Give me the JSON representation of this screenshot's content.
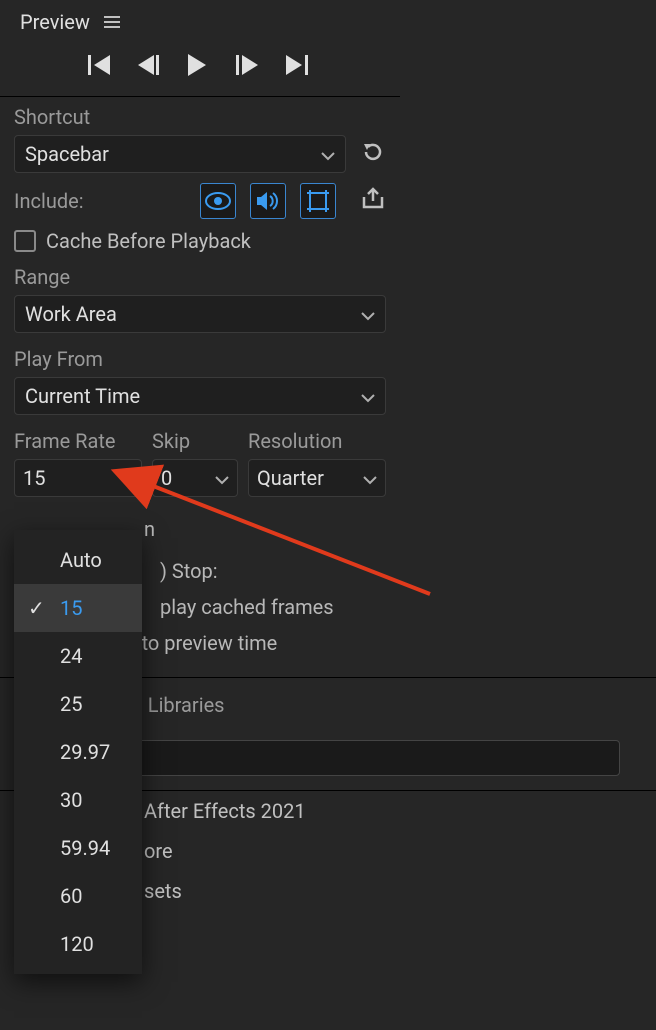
{
  "panel": {
    "title": "Preview"
  },
  "shortcut": {
    "label": "Shortcut",
    "value": "Spacebar"
  },
  "include": {
    "label": "Include:"
  },
  "cache": {
    "label": "Cache Before Playback"
  },
  "range": {
    "label": "Range",
    "value": "Work Area"
  },
  "playFrom": {
    "label": "Play From",
    "value": "Current Time"
  },
  "frameRate": {
    "label": "Frame Rate",
    "value": "15"
  },
  "skip": {
    "label": "Skip",
    "value": "0"
  },
  "resolution": {
    "label": "Resolution",
    "value": "Quarter"
  },
  "fullscreen_suffix": "n",
  "stop_label": ") Stop:",
  "stop_option1_suffix": "play cached frames",
  "stop_option2_suffix": "e to preview time",
  "frameRateOptions": [
    "Auto",
    "15",
    "24",
    "25",
    "29.97",
    "30",
    "59.94",
    "60",
    "120"
  ],
  "frameRateSelected": "15",
  "tabs": {
    "active": "sets",
    "lib": "Libraries"
  },
  "tree": {
    "item0_suffix": "After Effects 2021",
    "item1_suffix": "ore",
    "item2_suffix": "sets"
  }
}
